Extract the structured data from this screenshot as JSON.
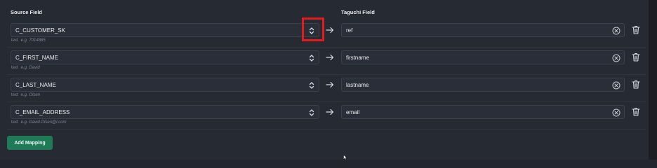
{
  "headers": {
    "source": "Source Field",
    "target": "Taguchi Field"
  },
  "mappings": [
    {
      "source": "C_CUSTOMER_SK",
      "type": "text",
      "example": "e.g. 7014865",
      "target": "ref"
    },
    {
      "source": "C_FIRST_NAME",
      "type": "text",
      "example": "e.g. David",
      "target": "firstname"
    },
    {
      "source": "C_LAST_NAME",
      "type": "text",
      "example": "e.g. Olsen",
      "target": "lastname"
    },
    {
      "source": "C_EMAIL_ADDRESS",
      "type": "text",
      "example": "e.g. David.Olsen@l.com",
      "target": "email"
    }
  ],
  "add_button": "Add Mapping",
  "icons": {
    "select": "chevron-up-down-icon",
    "arrow": "arrow-right-icon",
    "clear": "clear-circle-icon",
    "delete": "trash-icon",
    "cursor": "mouse-cursor-icon"
  },
  "colors": {
    "background": "#262a33",
    "field": "#2a2e38",
    "button": "#1f7a56",
    "highlight": "#e21b1b"
  }
}
